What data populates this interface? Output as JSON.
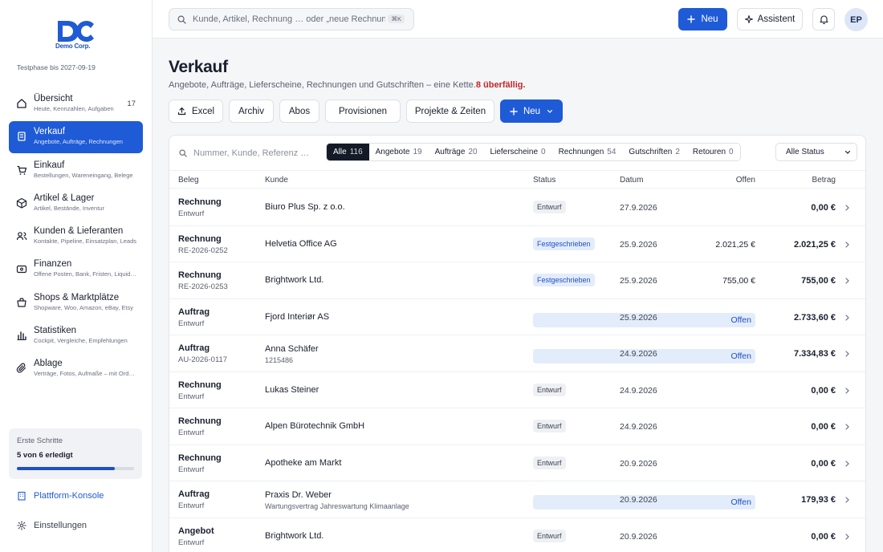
{
  "brand": {
    "logo_text": "Demo Corp.",
    "accent": "#1f5bd6",
    "trial_text": "Testphase bis 2027-09-19"
  },
  "sidebar": {
    "items": [
      {
        "title": "Übersicht",
        "sub": "Heute, Kennzahlen, Aufgaben",
        "count": "17",
        "icon": "home-icon",
        "active": false
      },
      {
        "title": "Verkauf",
        "sub": "Angebote, Aufträge, Rechnungen",
        "count": "",
        "icon": "receipt-icon",
        "active": true
      },
      {
        "title": "Einkauf",
        "sub": "Bestellungen, Wareneingang, Belege",
        "count": "",
        "icon": "cart-icon",
        "active": false
      },
      {
        "title": "Artikel & Lager",
        "sub": "Artikel, Bestände, Inventur",
        "count": "",
        "icon": "box-icon",
        "active": false
      },
      {
        "title": "Kunden & Lieferanten",
        "sub": "Kontakte, Pipeline, Einsatzplan, Leads",
        "count": "",
        "icon": "users-icon",
        "active": false
      },
      {
        "title": "Finanzen",
        "sub": "Offene Posten, Bank, Fristen, Liquidität",
        "count": "",
        "icon": "wallet-icon",
        "active": false
      },
      {
        "title": "Shops & Marktplätze",
        "sub": "Shopware, Woo, Amazon, eBay, Etsy",
        "count": "",
        "icon": "shop-icon",
        "active": false
      },
      {
        "title": "Statistiken",
        "sub": "Cockpit, Vergleiche, Empfehlungen",
        "count": "",
        "icon": "chart-icon",
        "active": false
      },
      {
        "title": "Ablage",
        "sub": "Verträge, Fotos, Aufmaße – mit Ordnern",
        "count": "",
        "icon": "paperclip-icon",
        "active": false
      }
    ],
    "onboarding": {
      "title": "Erste Schritte",
      "progress_text": "5 von 6 erledigt",
      "progress": 0.833
    },
    "platform_label": "Plattform-Konsole",
    "settings_label": "Einstellungen"
  },
  "topbar": {
    "search_placeholder": "Kunde, Artikel, Rechnung … oder „neue Rechnung“",
    "search_kbd": "⌘K",
    "new_label": "Neu",
    "assistant_label": "Assistent",
    "avatar_initials": "EP"
  },
  "page": {
    "title": "Verkauf",
    "subtitle": "Angebote, Aufträge, Lieferscheine, Rechnungen und Gutschriften – eine Kette.",
    "overdue": "8 überfällig.",
    "actions": [
      "Excel",
      "Archiv",
      "Abos",
      "Provisionen",
      "Projekte & Zeiten"
    ],
    "new_label": "Neu"
  },
  "filters": {
    "search_placeholder": "Nummer, Kunde, Referenz …",
    "segments": [
      {
        "label": "Alle",
        "count": "116",
        "active": true
      },
      {
        "label": "Angebote",
        "count": "19",
        "active": false
      },
      {
        "label": "Aufträge",
        "count": "20",
        "active": false
      },
      {
        "label": "Lieferscheine",
        "count": "0",
        "active": false
      },
      {
        "label": "Rechnungen",
        "count": "54",
        "active": false
      },
      {
        "label": "Gutschriften",
        "count": "2",
        "active": false
      },
      {
        "label": "Retouren",
        "count": "0",
        "active": false
      }
    ],
    "status_select": "Alle Status"
  },
  "table": {
    "headers": {
      "beleg": "Beleg",
      "kunde": "Kunde",
      "status": "Status",
      "datum": "Datum",
      "offen": "Offen",
      "betrag": "Betrag"
    },
    "rows": [
      {
        "type": "Rechnung",
        "number": "Entwurf",
        "kunde": "Biuro Plus Sp. z o.o.",
        "kunde_sub": "",
        "status": "Entwurf",
        "status_kind": "entwurf",
        "datum": "27.9.2026",
        "offen": "",
        "betrag": "0,00 €"
      },
      {
        "type": "Rechnung",
        "number": "RE-2026-0252",
        "kunde": "Helvetia Office AG",
        "kunde_sub": "",
        "status": "Festgeschrieben",
        "status_kind": "fest",
        "datum": "25.9.2026",
        "offen": "2.021,25 €",
        "betrag": "2.021,25 €"
      },
      {
        "type": "Rechnung",
        "number": "RE-2026-0253",
        "kunde": "Brightwork Ltd.",
        "kunde_sub": "",
        "status": "Festgeschrieben",
        "status_kind": "fest",
        "datum": "25.9.2026",
        "offen": "755,00 €",
        "betrag": "755,00 €"
      },
      {
        "type": "Auftrag",
        "number": "Entwurf",
        "kunde": "Fjord Interiør AS",
        "kunde_sub": "",
        "status": "Offen",
        "status_kind": "offen",
        "datum": "25.9.2026",
        "offen": "",
        "betrag": "2.733,60 €"
      },
      {
        "type": "Auftrag",
        "number": "AU-2026-0117",
        "kunde": "Anna Schäfer",
        "kunde_sub": "1215486",
        "status": "Offen",
        "status_kind": "offen",
        "datum": "24.9.2026",
        "offen": "",
        "betrag": "7.334,83 €"
      },
      {
        "type": "Rechnung",
        "number": "Entwurf",
        "kunde": "Lukas Steiner",
        "kunde_sub": "",
        "status": "Entwurf",
        "status_kind": "entwurf",
        "datum": "24.9.2026",
        "offen": "",
        "betrag": "0,00 €"
      },
      {
        "type": "Rechnung",
        "number": "Entwurf",
        "kunde": "Alpen Bürotechnik GmbH",
        "kunde_sub": "",
        "status": "Entwurf",
        "status_kind": "entwurf",
        "datum": "24.9.2026",
        "offen": "",
        "betrag": "0,00 €"
      },
      {
        "type": "Rechnung",
        "number": "Entwurf",
        "kunde": "Apotheke am Markt",
        "kunde_sub": "",
        "status": "Entwurf",
        "status_kind": "entwurf",
        "datum": "20.9.2026",
        "offen": "",
        "betrag": "0,00 €"
      },
      {
        "type": "Auftrag",
        "number": "Entwurf",
        "kunde": "Praxis Dr. Weber",
        "kunde_sub": "Wartungsvertrag Jahreswartung Klimaanlage",
        "status": "Offen",
        "status_kind": "offen",
        "datum": "20.9.2026",
        "offen": "",
        "betrag": "179,93 €"
      },
      {
        "type": "Angebot",
        "number": "Entwurf",
        "kunde": "Brightwork Ltd.",
        "kunde_sub": "",
        "status": "Entwurf",
        "status_kind": "entwurf",
        "datum": "20.9.2026",
        "offen": "",
        "betrag": "0,00 €"
      }
    ]
  }
}
